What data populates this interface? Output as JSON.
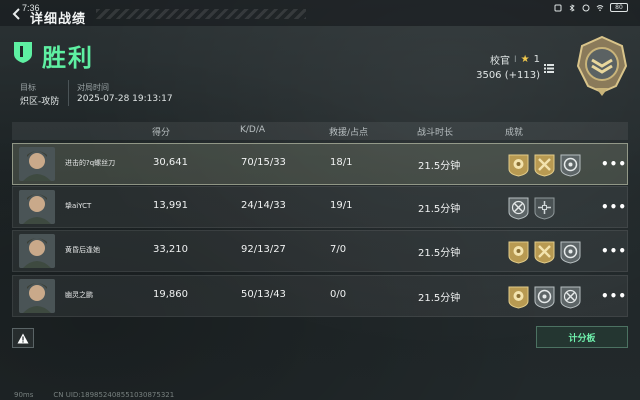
{
  "status_bar": {
    "time": "7:36",
    "battery": "80"
  },
  "header": {
    "title": "详细战绩"
  },
  "result": {
    "label": "胜利",
    "color": "#5ef0a2"
  },
  "match_info": {
    "target_label": "目标",
    "target_value": "炽区-攻防",
    "time_label": "对局时间",
    "time_value": "2025-07-28 19:13:17"
  },
  "rank": {
    "name": "校官",
    "sep": "I",
    "stars": "1",
    "score": "3506 (+113)"
  },
  "table": {
    "columns": [
      "得分",
      "K/D/A",
      "救援/占点",
      "战斗时长",
      "成就"
    ],
    "rows": [
      {
        "name": "进击的?q螺丝刀",
        "score": "30,641",
        "kda": "70/15/33",
        "rescue": "18/1",
        "duration": "21.5分钟",
        "me": true,
        "achievements": [
          "gold-flower-icon",
          "gold-crossed-axes-icon",
          "silver-target-icon"
        ]
      },
      {
        "name": "挚aiYCT",
        "score": "13,991",
        "kda": "24/14/33",
        "rescue": "19/1",
        "duration": "21.5分钟",
        "me": false,
        "achievements": [
          "silver-crossed-tools-icon",
          "silver-crosshair-icon"
        ]
      },
      {
        "name": "黄昏后逢她",
        "score": "33,210",
        "kda": "92/13/27",
        "rescue": "7/0",
        "duration": "21.5分钟",
        "me": false,
        "achievements": [
          "gold-flower-icon",
          "gold-crossed-axes-icon",
          "silver-target-icon"
        ]
      },
      {
        "name": "幽灵之鹏",
        "score": "19,860",
        "kda": "50/13/43",
        "rescue": "0/0",
        "duration": "21.5分钟",
        "me": false,
        "achievements": [
          "gold-flower-icon",
          "silver-target-icon",
          "silver-crossed-tools-icon"
        ]
      }
    ]
  },
  "buttons": {
    "scoreboard": "计分板",
    "more": "•••"
  },
  "footer": {
    "ping": "90ms",
    "uid": "CN UID:189852408551030875321"
  }
}
